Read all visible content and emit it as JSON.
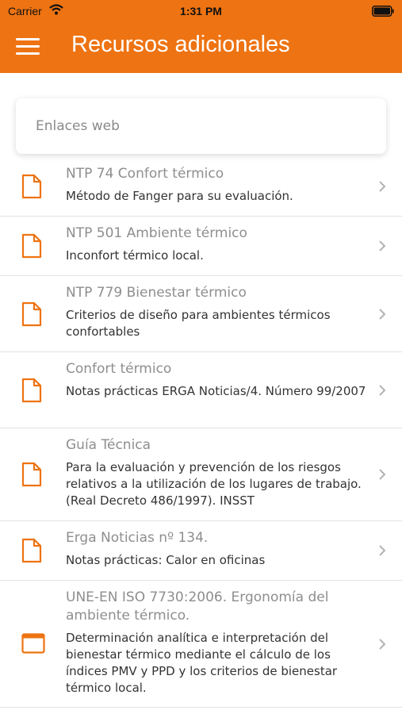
{
  "status": {
    "carrier": "Carrier",
    "time": "1:31 PM"
  },
  "header": {
    "title": "Recursos adicionales"
  },
  "section": {
    "label": "Enlaces web"
  },
  "items": [
    {
      "title": "NTP 74 Confort térmico",
      "subtitle": "Método de Fanger para su evaluación.",
      "icon": "document-icon"
    },
    {
      "title": "NTP 501 Ambiente térmico",
      "subtitle": "Inconfort térmico local.",
      "icon": "document-icon"
    },
    {
      "title": "NTP 779 Bienestar térmico",
      "subtitle": "Criterios de diseño para ambientes térmicos confortables",
      "icon": "document-icon"
    },
    {
      "title": "Confort térmico",
      "subtitle": "Notas prácticas ERGA Noticias/4. Número 99/2007",
      "icon": "document-icon"
    },
    {
      "title": "Guía Técnica",
      "subtitle": "Para la evaluación y prevención de los riesgos relativos a la utilización de los lugares de trabajo. (Real Decreto 486/1997). INSST",
      "icon": "document-icon"
    },
    {
      "title": "Erga Noticias nº 134.",
      "subtitle": "Notas prácticas: Calor en oficinas",
      "icon": "document-icon"
    },
    {
      "title": "UNE-EN ISO 7730:2006. Ergonomía del ambiente térmico.",
      "subtitle": "Determinación analítica e interpretación del bienestar térmico mediante el cálculo de los índices PMV y PPD y los criterios de bienestar térmico local.",
      "icon": "browser-window-icon"
    }
  ],
  "colors": {
    "accent": "#ee7312",
    "title_text": "#8e8e8e",
    "body_text": "#333333"
  }
}
